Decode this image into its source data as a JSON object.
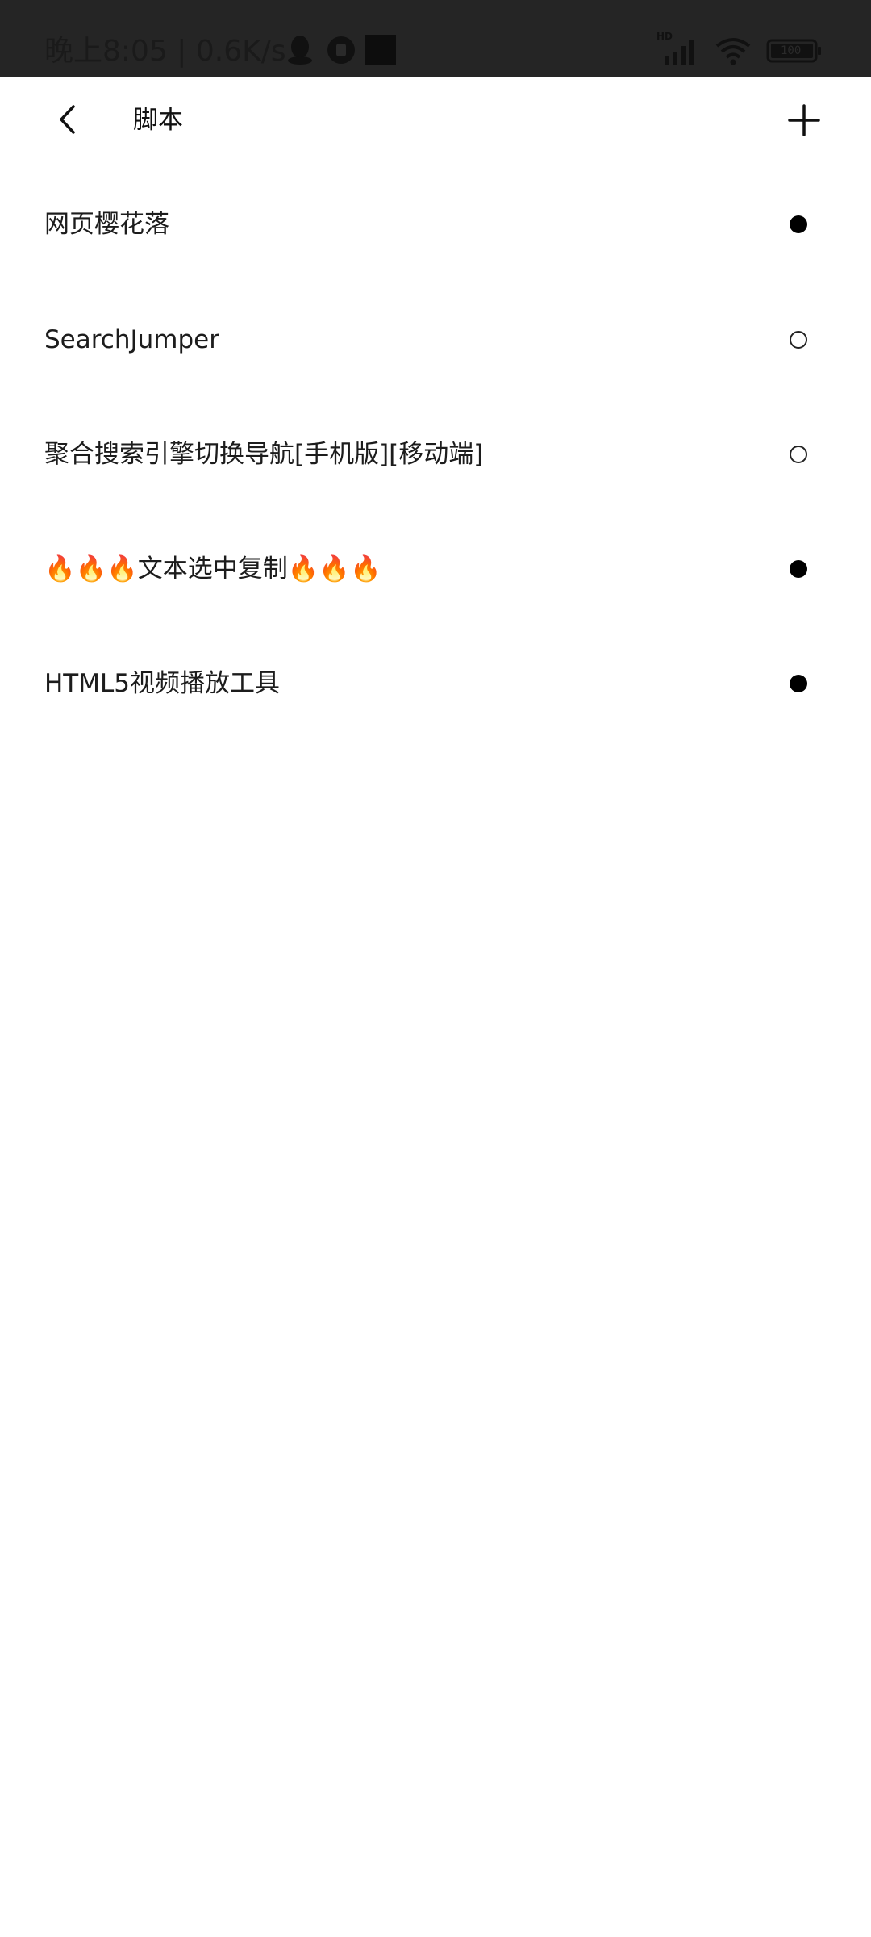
{
  "status_bar": {
    "time_and_speed": "晚上8:05 | 0.6K/s",
    "hd_label": "HD",
    "battery_label": "100"
  },
  "header": {
    "title": "脚本"
  },
  "scripts": [
    {
      "name": "网页樱花落",
      "enabled": true
    },
    {
      "name": "SearchJumper",
      "enabled": false
    },
    {
      "name": "聚合搜索引擎切换导航[手机版][移动端]",
      "enabled": false
    },
    {
      "name": "🔥🔥🔥文本选中复制🔥🔥🔥",
      "enabled": true
    },
    {
      "name": "HTML5视频播放工具",
      "enabled": true
    }
  ],
  "colors": {
    "status_bar_bg": "#252525",
    "page_bg": "#ffffff",
    "text": "#1c1c1c",
    "dot_on": "#000000"
  }
}
